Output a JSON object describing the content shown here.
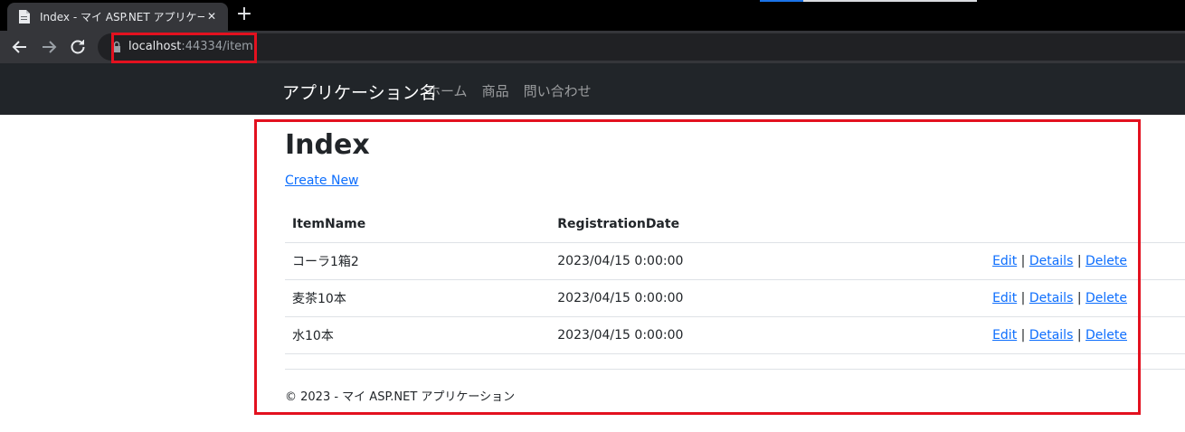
{
  "browser": {
    "tab_title": "Index - マイ ASP.NET アプリケーション",
    "close_glyph": "✕",
    "newtab_glyph": "+",
    "url_host": "localhost",
    "url_rest": ":44334/item"
  },
  "navbar": {
    "brand": "アプリケーション名",
    "links": [
      "ホーム",
      "商品",
      "問い合わせ"
    ]
  },
  "page": {
    "title": "Index",
    "create_link": "Create New"
  },
  "table": {
    "headers": [
      "ItemName",
      "RegistrationDate"
    ],
    "rows": [
      {
        "name": "コーラ1箱2",
        "date": "2023/04/15 0:00:00"
      },
      {
        "name": "麦茶10本",
        "date": "2023/04/15 0:00:00"
      },
      {
        "name": "水10本",
        "date": "2023/04/15 0:00:00"
      }
    ],
    "actions": {
      "edit": "Edit",
      "details": "Details",
      "delete": "Delete",
      "separator": "|"
    }
  },
  "footer": {
    "text": "© 2023 - マイ ASP.NET アプリケーション"
  },
  "colors": {
    "highlight": "#e3111f",
    "navbar_bg": "#212529",
    "link": "#0d6efd"
  }
}
